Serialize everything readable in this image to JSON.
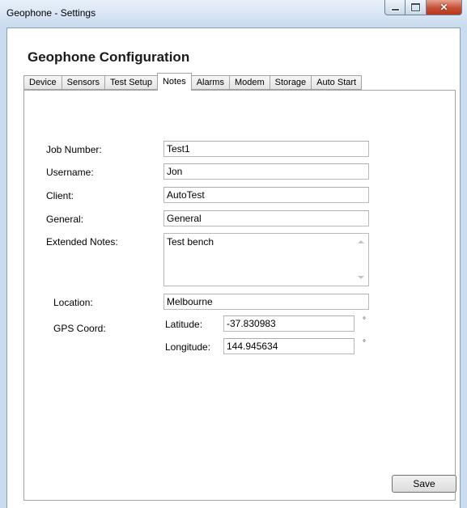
{
  "window": {
    "title": "Geophone - Settings"
  },
  "page_title": "Geophone Configuration",
  "tabs": [
    {
      "label": "Device",
      "active": false
    },
    {
      "label": "Sensors",
      "active": false
    },
    {
      "label": "Test Setup",
      "active": false
    },
    {
      "label": "Notes",
      "active": true
    },
    {
      "label": "Alarms",
      "active": false
    },
    {
      "label": "Modem",
      "active": false
    },
    {
      "label": "Storage",
      "active": false
    },
    {
      "label": "Auto Start",
      "active": false
    }
  ],
  "notes": {
    "job_number_label": "Job Number:",
    "job_number_value": "Test1",
    "username_label": "Username:",
    "username_value": "Jon",
    "client_label": "Client:",
    "client_value": "AutoTest",
    "general_label": "General:",
    "general_value": "General",
    "extended_notes_label": "Extended Notes:",
    "extended_notes_value": "Test bench",
    "location_label": "Location:",
    "location_value": "Melbourne",
    "gps_label": "GPS Coord:",
    "latitude_label": "Latitude:",
    "latitude_value": "-37.830983",
    "longitude_label": "Longitude:",
    "longitude_value": "144.945634",
    "degree_symbol": "°"
  },
  "buttons": {
    "save_label": "Save"
  },
  "icons": {
    "minimize": "minimize-icon",
    "maximize": "maximize-icon",
    "close": "close-icon"
  }
}
